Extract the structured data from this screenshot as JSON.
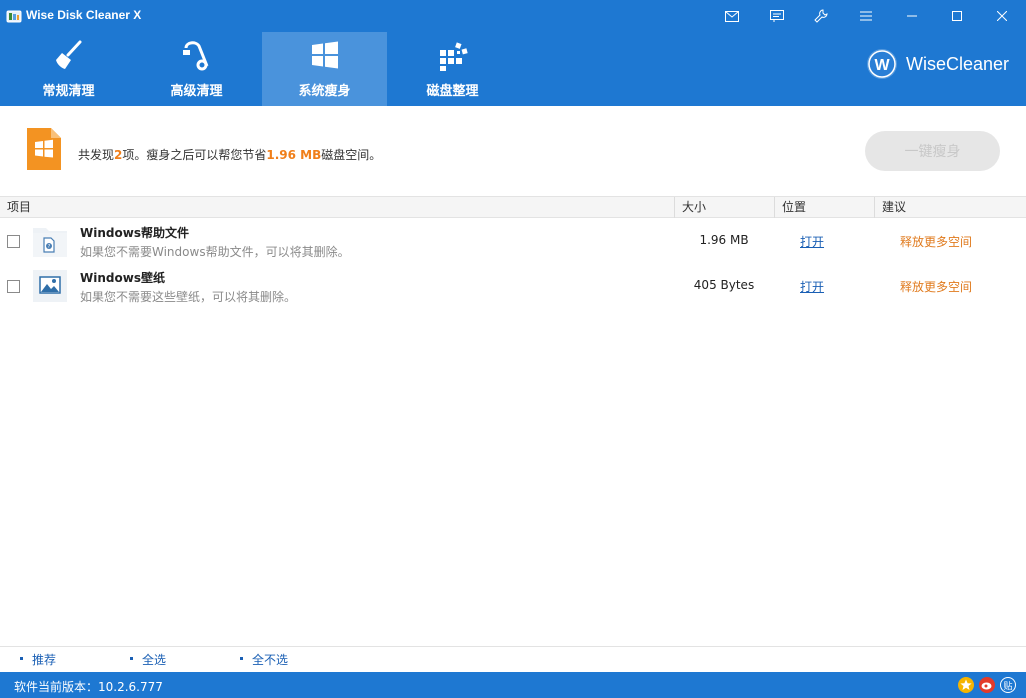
{
  "window": {
    "title": "Wise Disk Cleaner X",
    "controls": [
      "mail-icon",
      "feedback-icon",
      "tools-icon",
      "menu-icon",
      "minimize-icon",
      "maximize-icon",
      "close-icon"
    ]
  },
  "nav": {
    "tabs": [
      {
        "label": "常规清理",
        "icon": "broom-icon",
        "active": false
      },
      {
        "label": "高级清理",
        "icon": "vacuum-icon",
        "active": false
      },
      {
        "label": "系统瘦身",
        "icon": "windows-icon",
        "active": true
      },
      {
        "label": "磁盘整理",
        "icon": "defrag-icon",
        "active": false
      }
    ],
    "brand": "WiseCleaner"
  },
  "summary": {
    "prefix": "共发现",
    "count": "2",
    "middle": "项。瘦身之后可以帮您节省",
    "size": "1.96 MB",
    "suffix": "磁盘空间。",
    "button_label": "一键瘦身"
  },
  "table": {
    "headers": [
      "项目",
      "大小",
      "位置",
      "建议"
    ],
    "rows": [
      {
        "title": "Windows帮助文件",
        "desc": "如果您不需要Windows帮助文件，可以将其删除。",
        "size": "1.96 MB",
        "location": "打开",
        "advice": "释放更多空间",
        "icon": "help-file-icon",
        "checked": false
      },
      {
        "title": "Windows壁纸",
        "desc": "如果您不需要这些壁纸，可以将其删除。",
        "size": "405 Bytes",
        "location": "打开",
        "advice": "释放更多空间",
        "icon": "wallpaper-icon",
        "checked": false
      }
    ]
  },
  "bottom_links": [
    "推荐",
    "全选",
    "全不选"
  ],
  "status": {
    "version_text": "软件当前版本：10.2.6.777",
    "icons": [
      "upgrade-icon",
      "weibo-icon",
      "tieba-icon"
    ],
    "tieba_label": "贴"
  },
  "colors": {
    "primary": "#1e78d2",
    "active_tab": "#4a93dc",
    "highlight": "#f07f1a",
    "link": "#1a5fb4"
  }
}
